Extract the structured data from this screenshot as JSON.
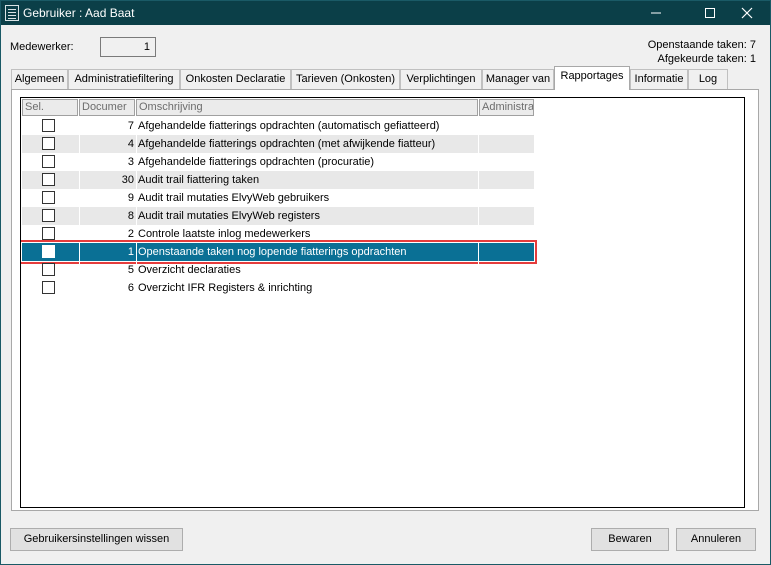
{
  "window": {
    "title": "Gebruiker : Aad Baat",
    "controls": {
      "minimize_icon": "minimize-icon",
      "maximize_icon": "maximize-icon",
      "close_icon": "close-icon"
    },
    "accent_color": "#0b3f48"
  },
  "header": {
    "medewerker_label": "Medewerker:",
    "medewerker_value": "1",
    "openstaande": "Openstaande taken: 7",
    "afgekeurde": "Afgekeurde taken: 1"
  },
  "tabs": [
    {
      "label": "Algemeen",
      "active": false
    },
    {
      "label": "Administratiefiltering",
      "active": false
    },
    {
      "label": "Onkosten Declaratie",
      "active": false
    },
    {
      "label": "Tarieven (Onkosten)",
      "active": false
    },
    {
      "label": "Verplichtingen",
      "active": false
    },
    {
      "label": "Manager van",
      "active": false
    },
    {
      "label": "Rapportages",
      "active": true
    },
    {
      "label": "Informatie",
      "active": false
    },
    {
      "label": "Log",
      "active": false
    }
  ],
  "grid": {
    "columns": [
      "Sel.",
      "Documer",
      "Omschrijving",
      "Administra"
    ],
    "selection_color": "#0a7095",
    "rows": [
      {
        "checked": false,
        "doc": "7",
        "omschrijving": "Afgehandelde fiatterings opdrachten (automatisch gefiatteerd)",
        "admin": "",
        "selected": false
      },
      {
        "checked": false,
        "doc": "4",
        "omschrijving": "Afgehandelde fiatterings opdrachten (met afwijkende fiatteur)",
        "admin": "",
        "selected": false
      },
      {
        "checked": false,
        "doc": "3",
        "omschrijving": "Afgehandelde fiatterings opdrachten (procuratie)",
        "admin": "",
        "selected": false
      },
      {
        "checked": false,
        "doc": "30",
        "omschrijving": "Audit trail fiattering taken",
        "admin": "",
        "selected": false
      },
      {
        "checked": false,
        "doc": "9",
        "omschrijving": "Audit trail mutaties ElvyWeb gebruikers",
        "admin": "",
        "selected": false
      },
      {
        "checked": false,
        "doc": "8",
        "omschrijving": "Audit trail mutaties ElvyWeb registers",
        "admin": "",
        "selected": false
      },
      {
        "checked": false,
        "doc": "2",
        "omschrijving": "Controle laatste inlog medewerkers",
        "admin": "",
        "selected": false
      },
      {
        "checked": false,
        "doc": "1",
        "omschrijving": "Openstaande taken nog lopende fiatterings opdrachten",
        "admin": "",
        "selected": true
      },
      {
        "checked": false,
        "doc": "5",
        "omschrijving": "Overzicht declaraties",
        "admin": "",
        "selected": false
      },
      {
        "checked": false,
        "doc": "6",
        "omschrijving": "Overzicht IFR Registers & inrichting",
        "admin": "",
        "selected": false
      }
    ]
  },
  "footer": {
    "reset_label": "Gebruikersinstellingen wissen",
    "save_label": "Bewaren",
    "cancel_label": "Annuleren"
  }
}
